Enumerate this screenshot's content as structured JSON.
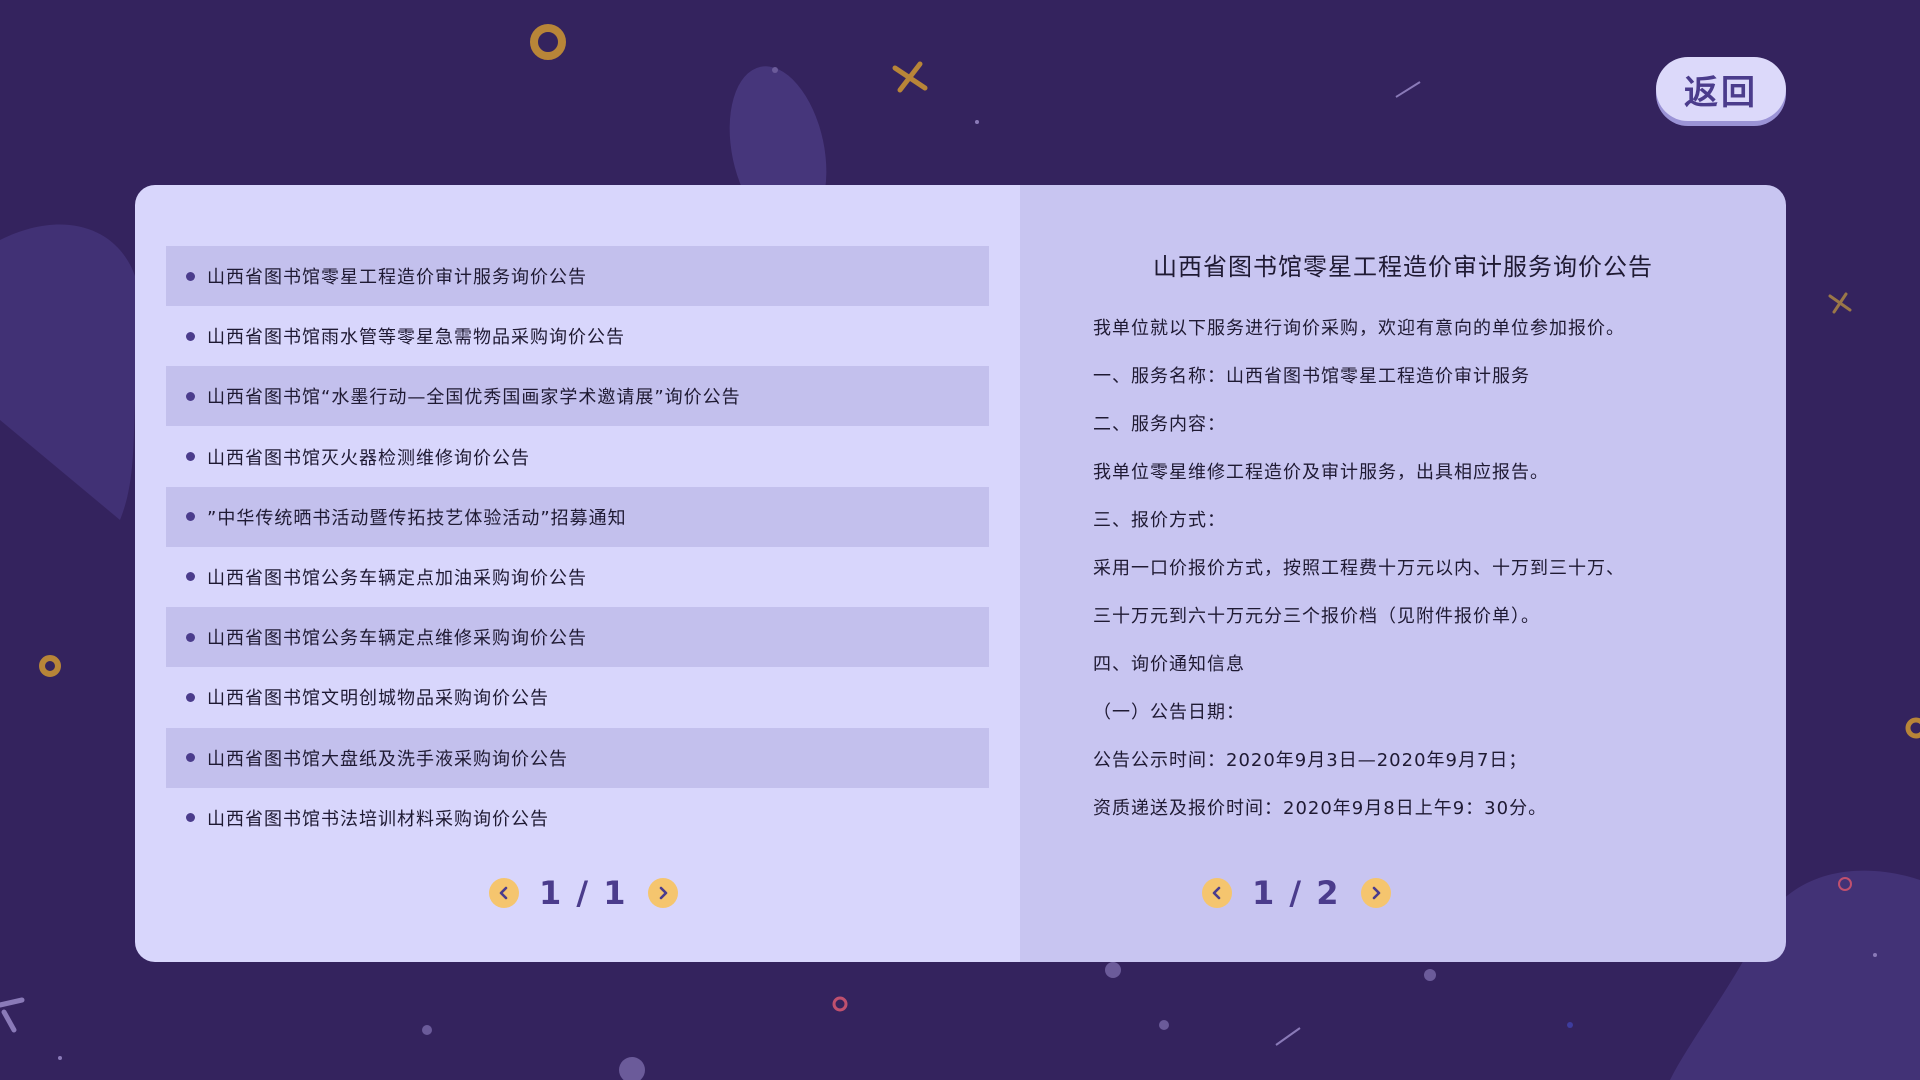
{
  "header": {
    "back_label": "返回"
  },
  "list": {
    "items": [
      "山西省图书馆零星工程造价审计服务询价公告",
      "山西省图书馆雨水管等零星急需物品采购询价公告",
      "山西省图书馆“水墨行动—全国优秀国画家学术邀请展”询价公告",
      "山西省图书馆灭火器检测维修询价公告",
      "”中华传统晒书活动暨传拓技艺体验活动”招募通知",
      "山西省图书馆公务车辆定点加油采购询价公告",
      "山西省图书馆公务车辆定点维修采购询价公告",
      "山西省图书馆文明创城物品采购询价公告",
      "山西省图书馆大盘纸及洗手液采购询价公告",
      "山西省图书馆书法培训材料采购询价公告"
    ],
    "pager": "1 / 1"
  },
  "detail": {
    "title": "山西省图书馆零星工程造价审计服务询价公告",
    "lines": [
      "我单位就以下服务进行询价采购，欢迎有意向的单位参加报价。",
      "一、服务名称：山西省图书馆零星工程造价审计服务",
      "二、服务内容：",
      "我单位零星维修工程造价及审计服务，出具相应报告。",
      "三、报价方式：",
      "采用一口价报价方式，按照工程费十万元以内、十万到三十万、",
      "三十万元到六十万元分三个报价档（见附件报价单）。",
      "四、询价通知信息",
      "（一）公告日期：",
      "公告公示时间：2020年9月3日—2020年9月7日；",
      "资质递送及报价时间：2020年9月8日上午9：30分。"
    ],
    "pager": "1 / 2"
  },
  "icons": {
    "prev": "chevron-left-icon",
    "next": "chevron-right-icon"
  },
  "colors": {
    "background": "#34235e",
    "accent": "#4b3c8c",
    "arrow": "#f5c56e",
    "list_panel": "#d8d6fc",
    "detail_panel": "#c8c5f1"
  }
}
